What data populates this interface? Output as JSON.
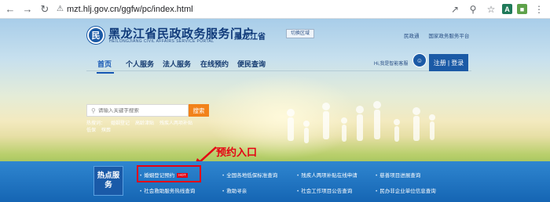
{
  "browser": {
    "url": "mzt.hlj.gov.cn/ggfw/pc/index.html",
    "extension_letter": "A",
    "extension_color": "#1f7a5a",
    "extension2_color": "#5ea24a"
  },
  "header": {
    "logo_glyph": "民",
    "title": "黑龙江省民政政务服务门户",
    "subtitle": "HEILONGJIANG CIVIL AFFAIRS SERVICE PORTAL",
    "region": "黑龙江省",
    "switch_label": "切换区域",
    "top_links": [
      "民政通",
      "国家政务服务平台"
    ]
  },
  "nav": {
    "items": [
      "首页",
      "个人服务",
      "法人服务",
      "在线预约",
      "便民查询"
    ],
    "kefu_label": "Hi,我是智能客服",
    "login_label": "注册 | 登录"
  },
  "search": {
    "placeholder": "请输入关键字搜索",
    "button_label": "搜索",
    "hot_label": "热搜词：",
    "hot_terms": [
      "婚姻登记",
      "高龄津贴",
      "残疾人两项补贴",
      "低保",
      "殡葬"
    ]
  },
  "annotation": {
    "label": "预约入口",
    "color": "#e60012"
  },
  "hot_services": {
    "badge": "热点服务",
    "links": [
      {
        "label": "婚姻登记预约",
        "hot": "HOT"
      },
      {
        "label": "全国各地低保标准查询"
      },
      {
        "label": "残疾人两项补贴在线申请"
      },
      {
        "label": "慈善项目进展查询"
      },
      {
        "label": "社会救助服务热线查询"
      },
      {
        "label": "救助寻亲"
      },
      {
        "label": "社会工作项目公告查询"
      },
      {
        "label": "民办非企业单位信息查询"
      }
    ]
  },
  "colors": {
    "primary": "#1b5aa6",
    "accent": "#f2821a",
    "strip": "#1f72c2"
  }
}
